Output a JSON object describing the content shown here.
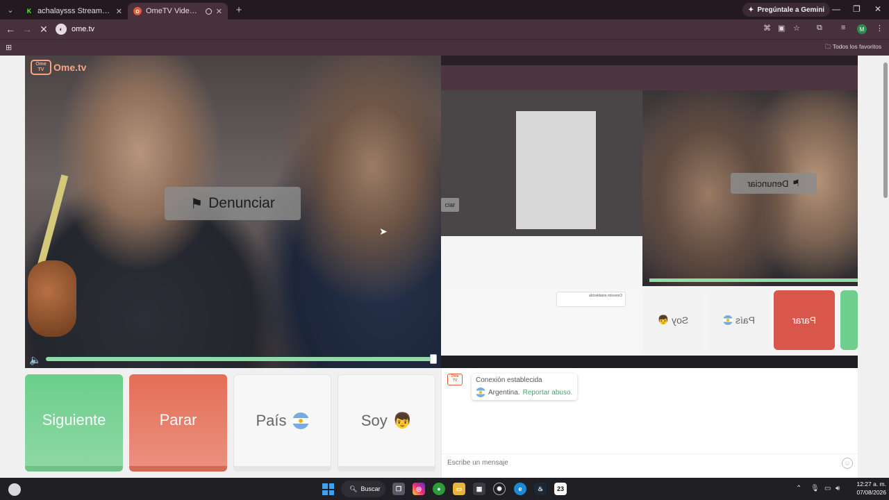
{
  "browser": {
    "tabs": [
      {
        "title": "achalaysss Stream - Watch Live",
        "favicon": "kick-icon",
        "active": false
      },
      {
        "title": "OmeTV Video Chat — Ome",
        "favicon": "ometv-icon",
        "active": true
      }
    ],
    "gemini_label": "Pregúntale a Gemini",
    "url": "ome.tv",
    "profile_initial": "M",
    "bookmarks_label": "Todos los favoritos"
  },
  "video": {
    "logo_text": "Ome.tv",
    "logo_box_text": "Ome TV",
    "report_label": "Denunciar",
    "mirrored_report_label": "Denunciar",
    "mini_report_label": "ciar"
  },
  "remote_buttons": {
    "stop": "Parar",
    "country": "País",
    "gender": "Soy"
  },
  "controls": {
    "next_label": "Siguiente",
    "stop_label": "Parar",
    "country_label": "País",
    "gender_label": "Soy",
    "country_flag": "argentina-flag-icon",
    "gender_icon": "boy-emoji-icon"
  },
  "chat": {
    "connection_text": "Conexión establecida",
    "country_text": "Argentina.",
    "report_link": "Reportar abuso.",
    "input_placeholder": "Escribe un mensaje"
  },
  "taskbar": {
    "search_label": "Buscar",
    "steam_badge": "23",
    "time": "12:27 a. m.",
    "date": "07/08/2026"
  },
  "colors": {
    "next_green": "#6bcf8b",
    "stop_red": "#e36e56",
    "accent_orange": "#f7a583",
    "link_green": "#4aa36a"
  }
}
